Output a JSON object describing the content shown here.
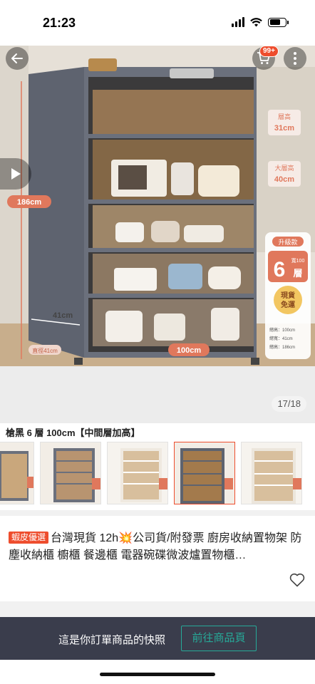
{
  "status_bar": {
    "time": "21:23"
  },
  "nav": {
    "cart_badge": "99+"
  },
  "gallery": {
    "counter": "17/18",
    "hero_labels": {
      "top_gap_label": "層高",
      "top_gap_value": "31cm",
      "large_gap_label": "大層高",
      "large_gap_value": "40cm",
      "height": "186cm",
      "depth": "41cm",
      "width": "100cm",
      "depth_side": "直徑41cm",
      "upgrade": "升級款",
      "tiers": "6",
      "tiers_unit": "層",
      "width_tag": "寬100",
      "stock_line1": "現貨",
      "stock_line2": "免運",
      "spec1": "總高：100cm",
      "spec2": "總寬：41cm",
      "spec3": "總高：186cm"
    }
  },
  "variation": {
    "selected_label": "槍黑 6 層 100cm【中間層加高】",
    "selected_index": 3
  },
  "product": {
    "badge": "蝦皮優選",
    "title": "台灣現貨 12h💥公司貨/附發票 廚房收納置物架 防塵收納櫃 櫥櫃 餐邊櫃 電器碗碟微波爐置物櫃…"
  },
  "footer": {
    "snapshot_text": "這是你訂單商品的快照",
    "goto_button": "前往商品頁"
  },
  "colors": {
    "accent": "#ee4d2d",
    "teal": "#26aa99",
    "footer_bg": "#3a3d4c"
  }
}
